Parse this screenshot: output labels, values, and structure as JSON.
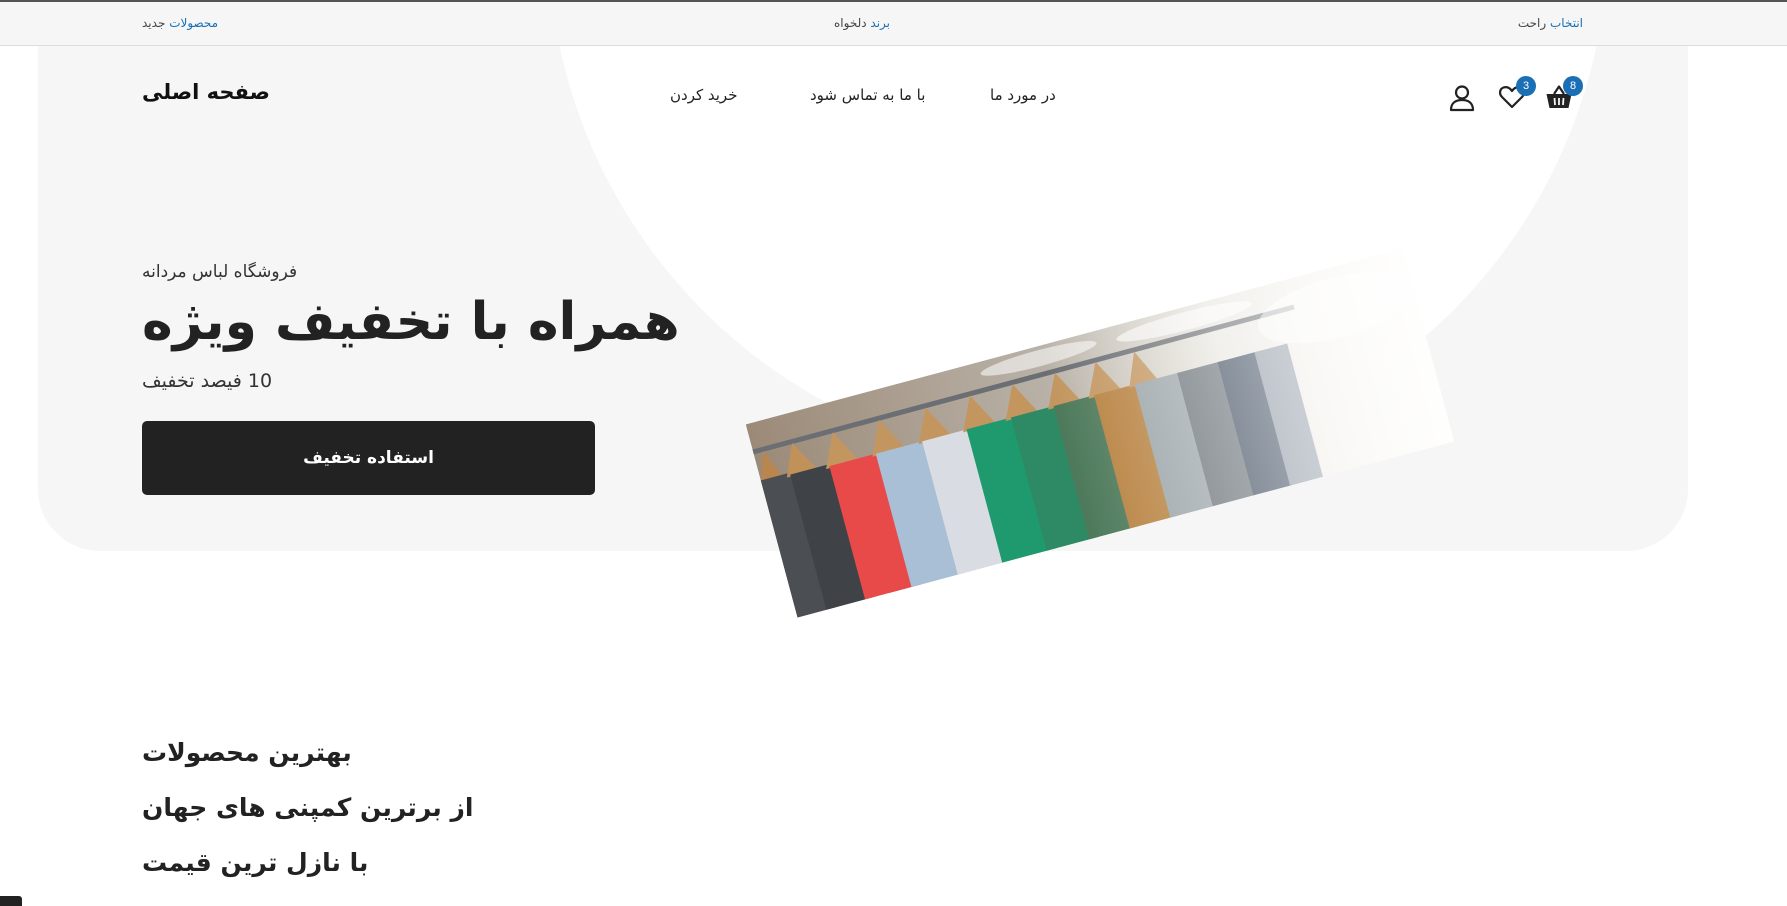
{
  "topbar": {
    "right": {
      "accent": "انتخاب",
      "muted": "راحت"
    },
    "center": {
      "accent": "برند",
      "muted": "دلخواه"
    },
    "left": {
      "accent": "محصولات",
      "muted": "جدید"
    }
  },
  "header": {
    "logo": "صفحه اصلی",
    "nav": {
      "shop": "خرید کردن",
      "contact": "با ما به تماس شود",
      "about": "در مورد ما"
    },
    "icons": {
      "user": "user-icon",
      "wishlist": "heart-icon",
      "cart": "basket-icon"
    },
    "wishlist_count": "3",
    "cart_count": "8"
  },
  "hero": {
    "kicker": "فروشگاه لباس مردانه",
    "headline": "همراه با تخفیف ویژه",
    "sub": "10 فیصد تخفیف",
    "cta": "استفاده تخفیف"
  },
  "features": [
    "بهترین محصولات",
    "از برترین کمپنی های جهان",
    "با نازل ترین قیمت"
  ],
  "colors": {
    "accent": "#1a6fb5",
    "dark": "#222222",
    "hero_bg": "#f6f6f6"
  }
}
